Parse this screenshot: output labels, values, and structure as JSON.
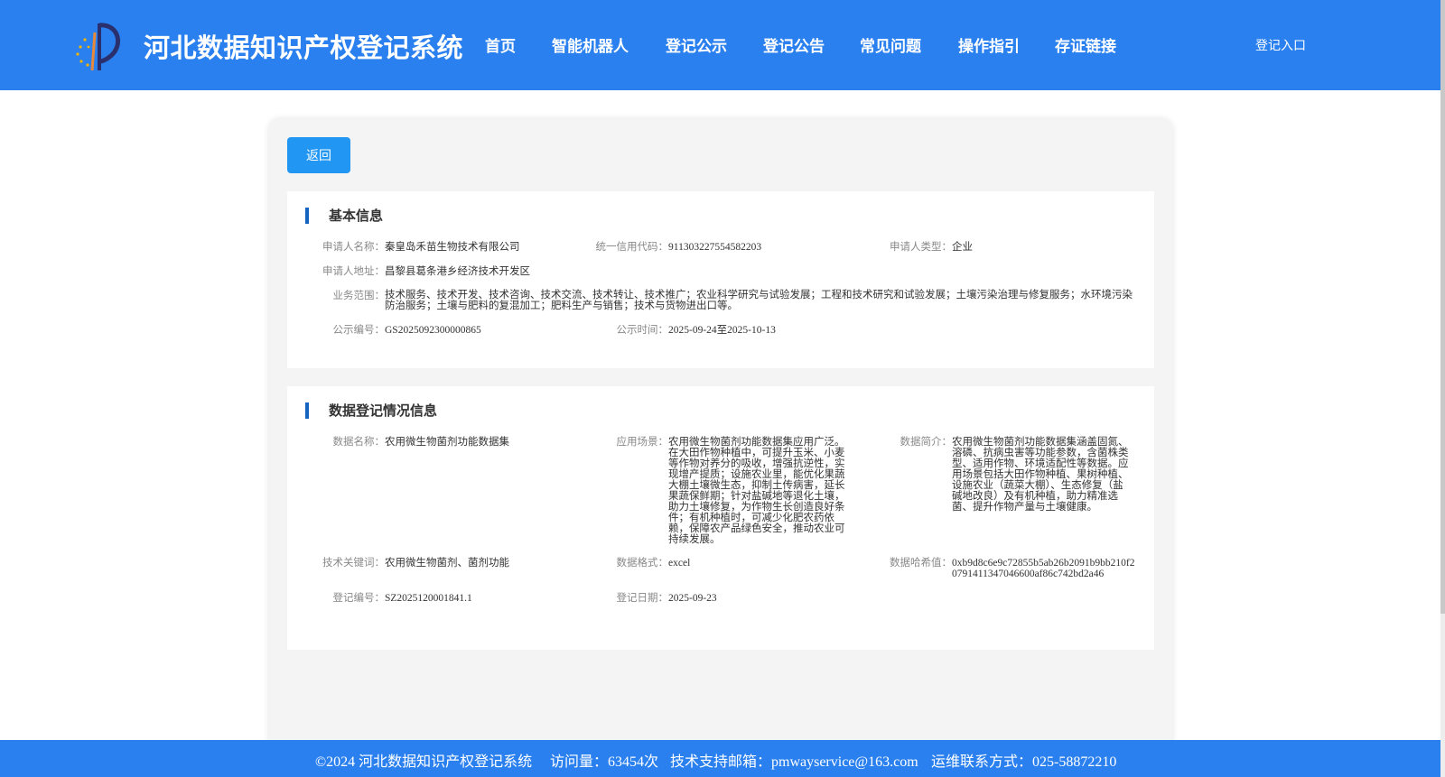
{
  "header": {
    "title": "河北数据知识产权登记系统",
    "nav": [
      "首页",
      "智能机器人",
      "登记公示",
      "登记公告",
      "常见问题",
      "操作指引",
      "存证链接"
    ],
    "login": "登记入口"
  },
  "back_label": "返回",
  "basic": {
    "title": "基本信息",
    "applicant_name": {
      "label": "申请人名称：",
      "value": "秦皇岛禾苗生物技术有限公司"
    },
    "credit_code": {
      "label": "统一信用代码：",
      "value": "911303227554582203"
    },
    "applicant_type": {
      "label": "申请人类型：",
      "value": "企业"
    },
    "address": {
      "label": "申请人地址：",
      "value": "昌黎县葛条港乡经济技术开发区"
    },
    "scope": {
      "label": "业务范围：",
      "value": "技术服务、技术开发、技术咨询、技术交流、技术转让、技术推广；农业科学研究与试验发展；工程和技术研究和试验发展；土壤污染治理与修复服务；水环境污染防治服务；土壤与肥料的复混加工；肥料生产与销售；技术与货物进出口等。"
    },
    "notice_no": {
      "label": "公示编号：",
      "value": "GS2025092300000865"
    },
    "notice_time": {
      "label": "公示时间：",
      "value": "2025-09-24至2025-10-13"
    }
  },
  "data_reg": {
    "title": "数据登记情况信息",
    "data_name": {
      "label": "数据名称：",
      "value": "农用微生物菌剂功能数据集"
    },
    "scenario": {
      "label": "应用场景：",
      "value": "农用微生物菌剂功能数据集应用广泛。在大田作物种植中，可提升玉米、小麦等作物对养分的吸收，增强抗逆性，实现增产提质；设施农业里，能优化果蔬大棚土壤微生态，抑制土传病害，延长果蔬保鲜期；针对盐碱地等退化土壤，助力土壤修复，为作物生长创造良好条件；有机种植时，可减少化肥农药依赖，保障农产品绿色安全，推动农业可持续发展。"
    },
    "summary": {
      "label": "数据简介：",
      "value": "农用微生物菌剂功能数据集涵盖固氮、溶磷、抗病虫害等功能参数，含菌株类型、适用作物、环境适配性等数据。应用场景包括大田作物种植、果树种植、设施农业（蔬菜大棚）、生态修复（盐碱地改良）及有机种植，助力精准选菌、提升作物产量与土壤健康。"
    },
    "keywords": {
      "label": "技术关键词：",
      "value": "农用微生物菌剂、菌剂功能"
    },
    "format": {
      "label": "数据格式：",
      "value": "excel"
    },
    "hash": {
      "label": "数据哈希值：",
      "value": "0xb9d8c6e9c72855b5ab26b2091b9bb210f20791411347046600af86c742bd2a46"
    },
    "reg_no": {
      "label": "登记编号：",
      "value": "SZ2025120001841.1"
    },
    "reg_date": {
      "label": "登记日期：",
      "value": "2025-09-23"
    }
  },
  "footer": {
    "copyright": "©2024 河北数据知识产权登记系统",
    "visits": "访问量：63454次",
    "email": "技术支持邮箱：pmwayservice@163.com",
    "phone": "运维联系方式：025-58872210"
  },
  "colors": {
    "primary": "#2a80ee",
    "button": "#2196f3",
    "title_bar": "#1565c0"
  }
}
